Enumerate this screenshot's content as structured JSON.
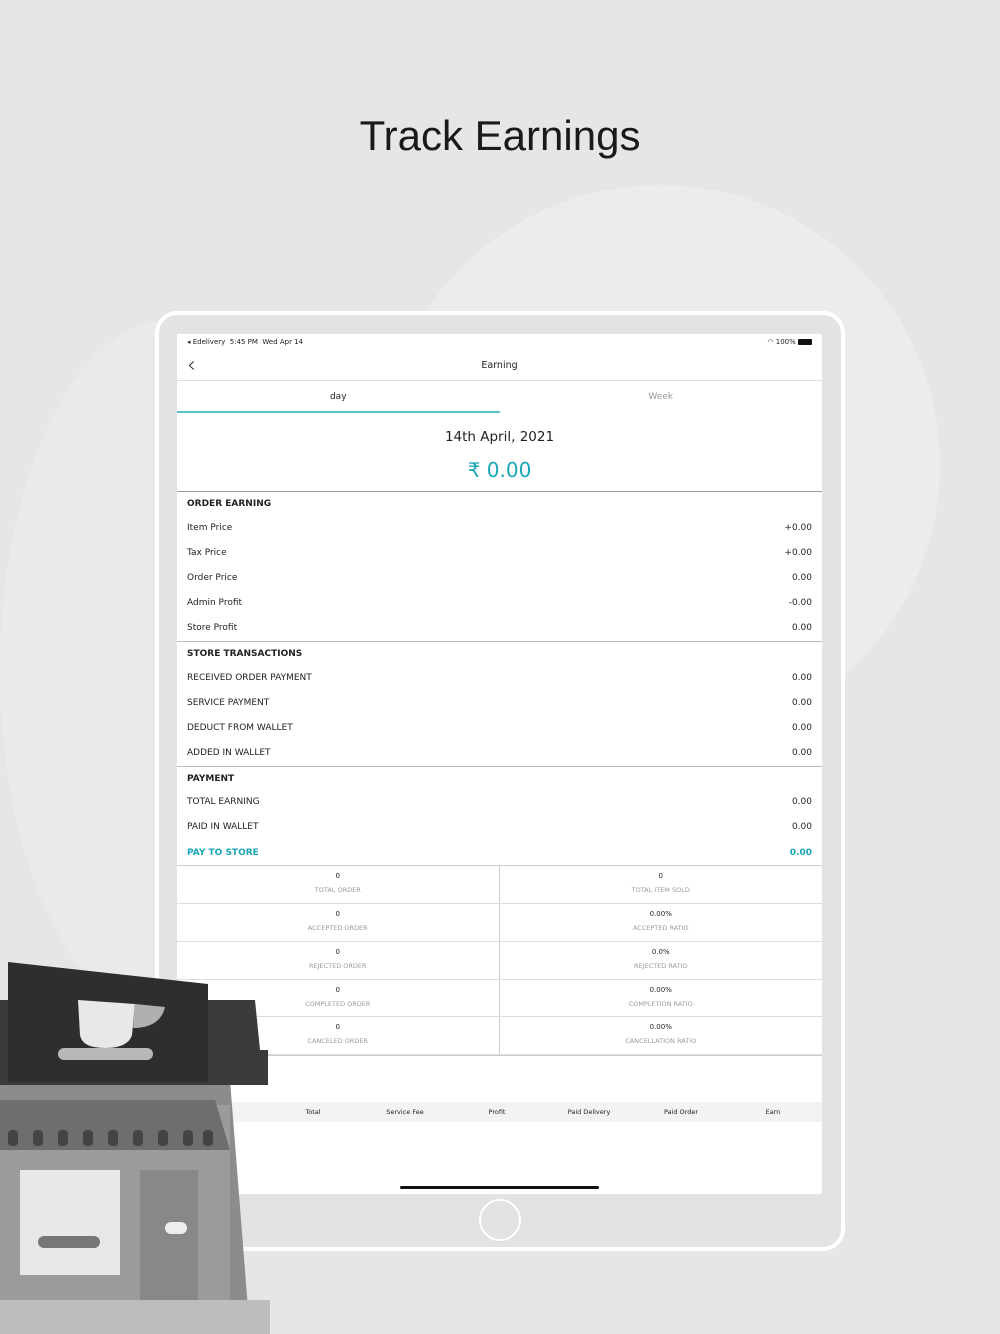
{
  "headline": "Track Earnings",
  "status": {
    "app": "◂ Edelivery",
    "time": "5:45 PM",
    "date": "Wed Apr 14",
    "battery": "100%"
  },
  "nav": {
    "title": "Earning"
  },
  "tabs": [
    {
      "label": "day"
    },
    {
      "label": "Week"
    }
  ],
  "date": "14th April, 2021",
  "total": "₹ 0.00",
  "order_earning": {
    "title": "ORDER EARNING",
    "rows": [
      {
        "label": "Item Price",
        "value": "+0.00"
      },
      {
        "label": "Tax Price",
        "value": "+0.00"
      },
      {
        "label": "Order Price",
        "value": "0.00"
      },
      {
        "label": "Admin Profit",
        "value": "-0.00"
      },
      {
        "label": "Store Profit",
        "value": "0.00"
      }
    ]
  },
  "store_transactions": {
    "title": "STORE TRANSACTIONS",
    "rows": [
      {
        "label": "RECEIVED ORDER PAYMENT",
        "value": "0.00"
      },
      {
        "label": "SERVICE PAYMENT",
        "value": "0.00"
      },
      {
        "label": "DEDUCT FROM WALLET",
        "value": "0.00"
      },
      {
        "label": "ADDED IN WALLET",
        "value": "0.00"
      }
    ]
  },
  "payment": {
    "title": "PAYMENT",
    "rows": [
      {
        "label": "TOTAL EARNING",
        "value": "0.00"
      },
      {
        "label": "PAID IN WALLET",
        "value": "0.00"
      },
      {
        "label": "PAY TO STORE",
        "value": "0.00"
      }
    ]
  },
  "stats": [
    {
      "value": "0",
      "label": "TOTAL ORDER"
    },
    {
      "value": "0",
      "label": "TOTAL ITEM SOLD"
    },
    {
      "value": "0",
      "label": "ACCEPTED ORDER"
    },
    {
      "value": "0.00%",
      "label": "ACCEPTED RATIO"
    },
    {
      "value": "0",
      "label": "REJECTED ORDER"
    },
    {
      "value": "0.0%",
      "label": "REJECTED RATIO"
    },
    {
      "value": "0",
      "label": "COMPLETED ORDER"
    },
    {
      "value": "0.00%",
      "label": "COMPLETION RATIO"
    },
    {
      "value": "0",
      "label": "CANCELED ORDER"
    },
    {
      "value": "0.00%",
      "label": "CANCELLATION RATIO"
    }
  ],
  "table_headers": [
    "Total",
    "Service Fee",
    "Profit",
    "Paid Delivery",
    "Paid Order",
    "Earn"
  ],
  "accent": "#1aa6b7"
}
